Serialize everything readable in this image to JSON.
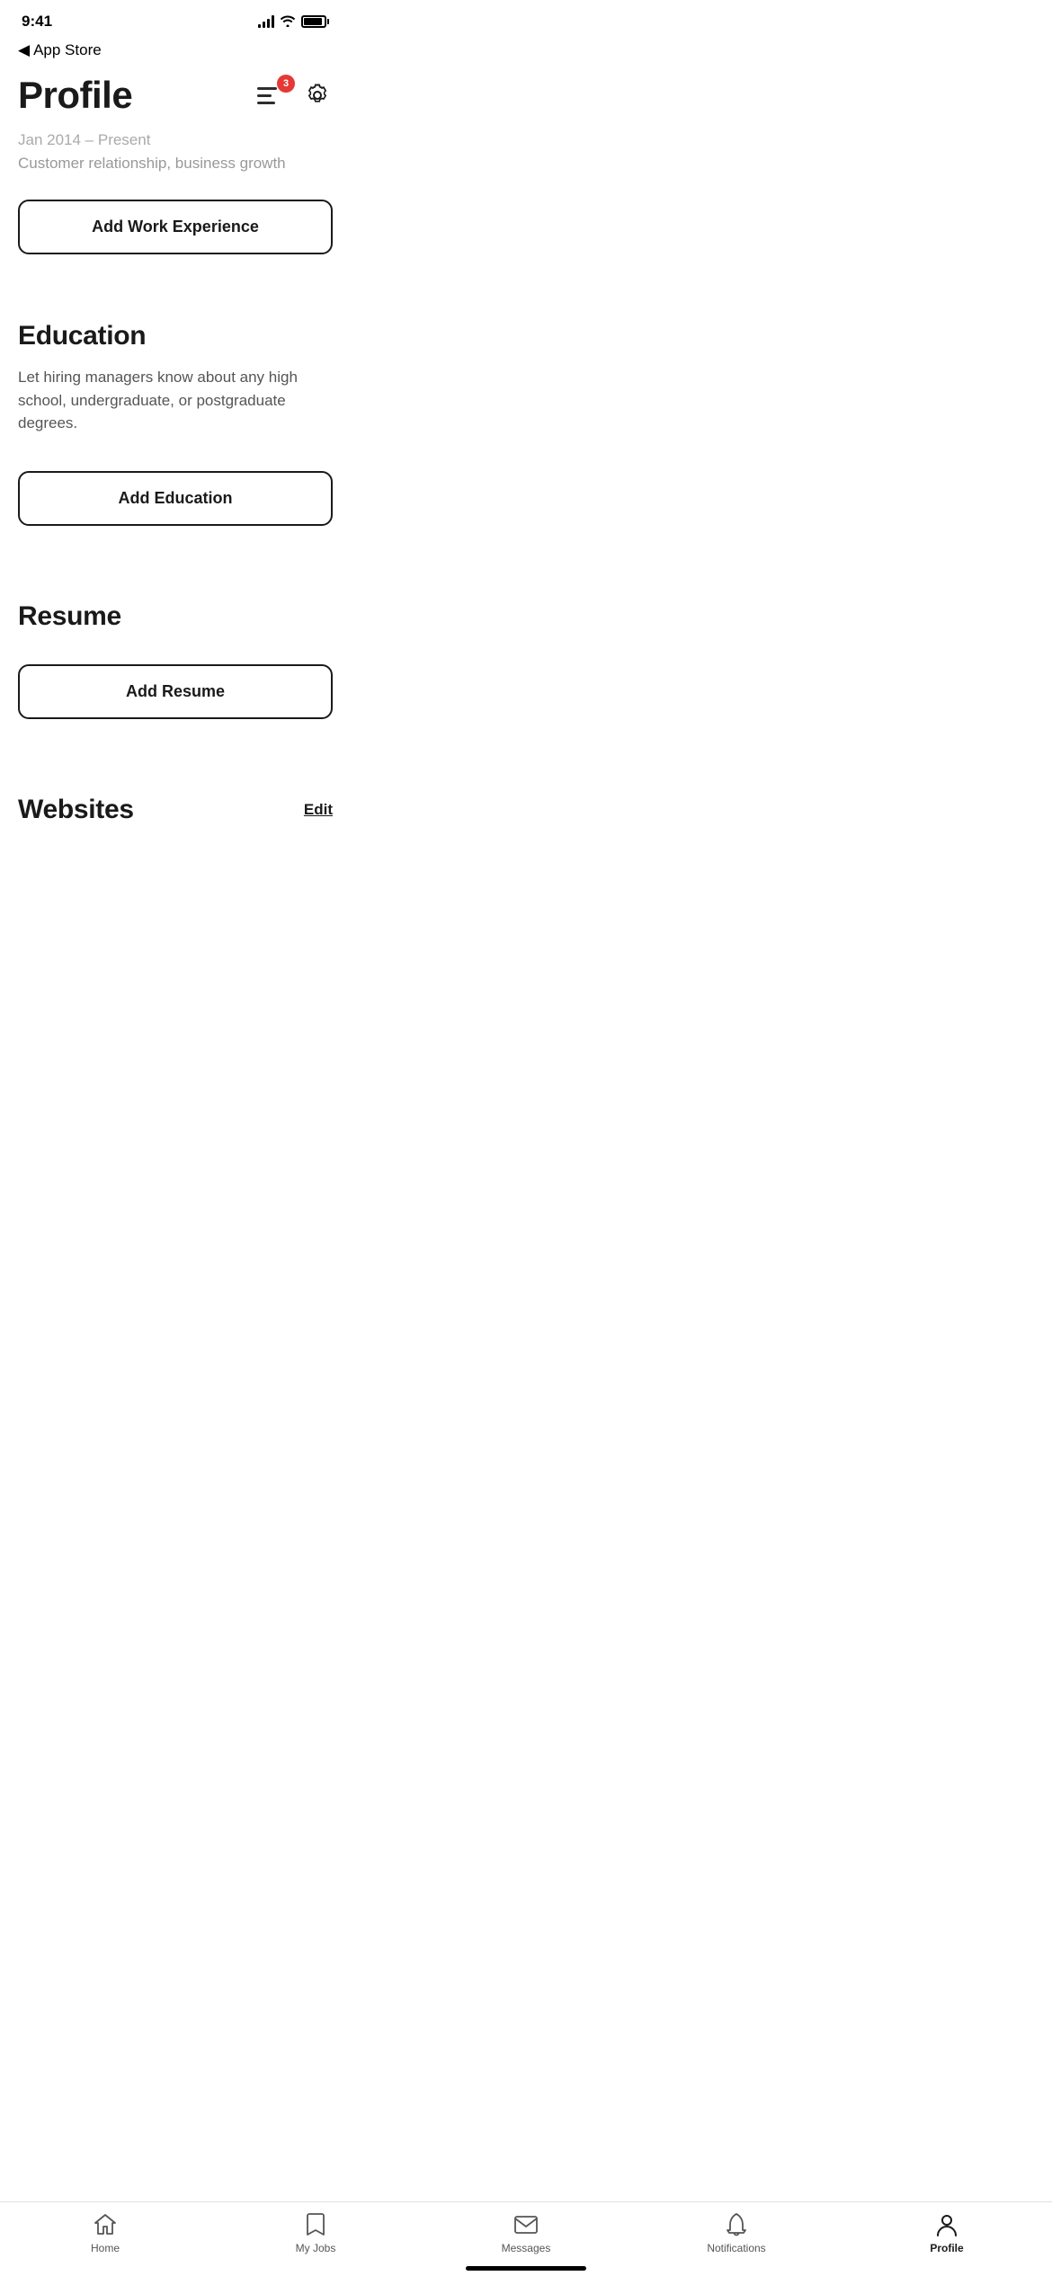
{
  "statusBar": {
    "time": "9:41",
    "backLabel": "App Store"
  },
  "header": {
    "title": "Profile",
    "notificationCount": "3"
  },
  "fadedSection": {
    "dateRange": "Jan 2014 – Present",
    "description": "Customer relationship, business growth"
  },
  "workExperience": {
    "buttonLabel": "Add Work Experience"
  },
  "education": {
    "title": "Education",
    "description": "Let hiring managers know about any high school, undergraduate, or postgraduate degrees.",
    "buttonLabel": "Add Education"
  },
  "resume": {
    "title": "Resume",
    "buttonLabel": "Add Resume"
  },
  "websites": {
    "title": "Websites",
    "editLabel": "Edit"
  },
  "bottomNav": {
    "items": [
      {
        "label": "Home",
        "icon": "home-icon",
        "active": false
      },
      {
        "label": "My Jobs",
        "icon": "bookmark-icon",
        "active": false
      },
      {
        "label": "Messages",
        "icon": "mail-icon",
        "active": false
      },
      {
        "label": "Notifications",
        "icon": "bell-icon",
        "active": false
      },
      {
        "label": "Profile",
        "icon": "person-icon",
        "active": true
      }
    ]
  }
}
